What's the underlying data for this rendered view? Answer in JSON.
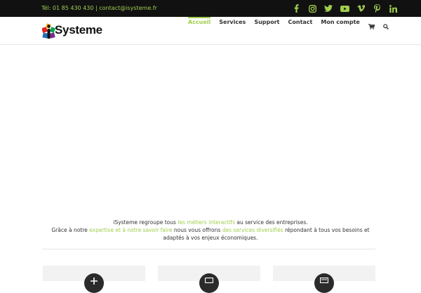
{
  "topbar": {
    "phone": "Tél: 01 85 430 430",
    "separator": "|",
    "email": "contact@isysteme.fr",
    "socials": [
      {
        "icon": "facebook-icon"
      },
      {
        "icon": "instagram-icon"
      },
      {
        "icon": "twitter-icon"
      },
      {
        "icon": "youtube-icon"
      },
      {
        "icon": "vimeo-icon"
      },
      {
        "icon": "pinterest-icon"
      },
      {
        "icon": "linkedin-icon"
      }
    ]
  },
  "brand": {
    "name": "Systeme"
  },
  "nav": {
    "items": [
      {
        "label": "Accueil",
        "active": true
      },
      {
        "label": "Services"
      },
      {
        "label": "Support"
      },
      {
        "label": "Contact"
      },
      {
        "label": "Mon compte"
      }
    ],
    "cart_icon": "cart-icon",
    "search_icon": "search-icon"
  },
  "intro": {
    "p1_a": "iSysteme regroupe tous ",
    "p1_hl": "les métiers interactifs",
    "p1_b": " au service des entreprises.",
    "p2_a": "Grâce à notre ",
    "p2_hl1": "expertise et à notre savoir faire",
    "p2_b": " nous vous offrons ",
    "p2_hl2": "des services diversifiés",
    "p2_c": " répondant à tous vos besoins et adaptés à vos enjeux économiques."
  },
  "cards": [
    {
      "icon": "service-icon-1"
    },
    {
      "icon": "service-icon-2"
    },
    {
      "icon": "service-icon-3"
    }
  ],
  "colors": {
    "accent": "#a0ce4e",
    "topbar_bg": "#111111",
    "text": "#333333",
    "card_bg": "#f2f2f2"
  }
}
